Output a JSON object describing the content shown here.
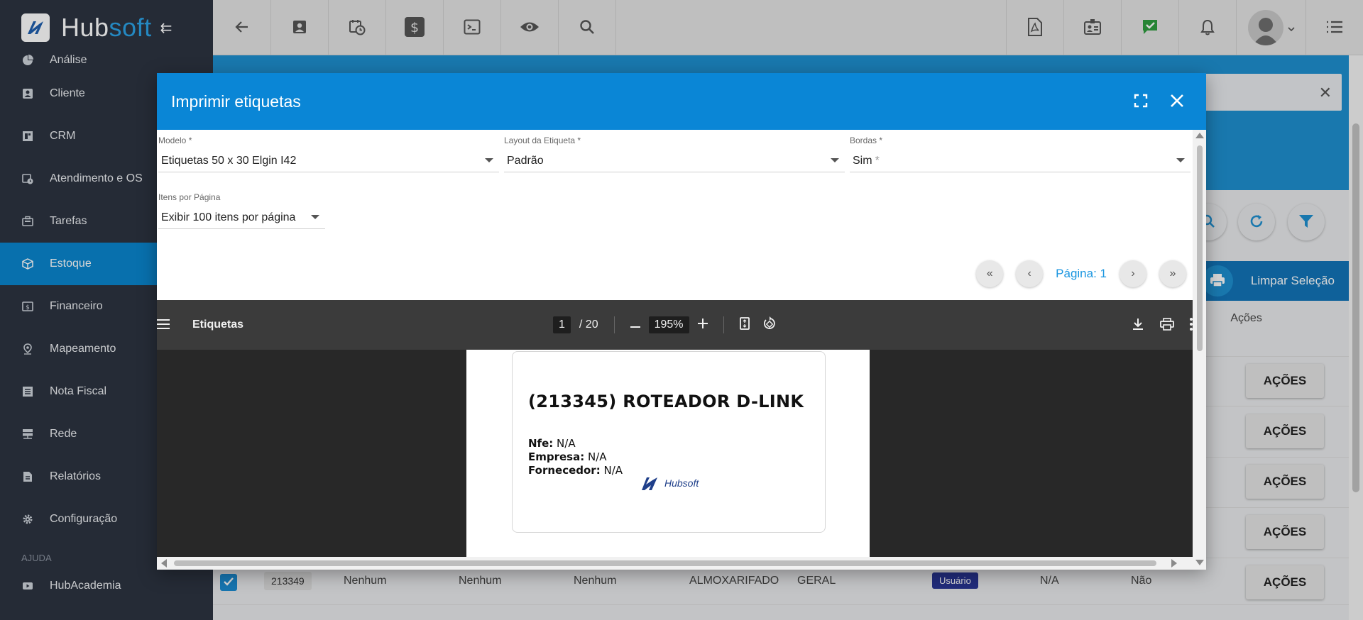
{
  "app": {
    "brand": {
      "part1": "Hub",
      "part2": "soft"
    },
    "colors": {
      "primary": "#0a86d6",
      "sidebar": "#2d3441",
      "accent_link": "#1b96e0",
      "badge": "#283593"
    }
  },
  "topbar": {
    "left_icons": [
      "back-arrow-icon",
      "contact-card-icon",
      "calendar-clock-icon",
      "dollar-icon",
      "terminal-icon",
      "eye-icon",
      "search-icon"
    ],
    "right_icons": [
      "pdf-icon",
      "id-card-icon",
      "check-icon",
      "bell-icon",
      "avatar",
      "list-icon"
    ]
  },
  "sidebar": {
    "items": [
      {
        "label": "Análise",
        "icon": "pie-chart-icon"
      },
      {
        "label": "Cliente",
        "icon": "contact-card-icon"
      },
      {
        "label": "CRM",
        "icon": "dashboard-icon"
      },
      {
        "label": "Atendimento e OS",
        "icon": "calendar-clock-icon"
      },
      {
        "label": "Tarefas",
        "icon": "briefcase-icon"
      },
      {
        "label": "Estoque",
        "icon": "cube-icon"
      },
      {
        "label": "Financeiro",
        "icon": "money-icon"
      },
      {
        "label": "Mapeamento",
        "icon": "map-pin-icon"
      },
      {
        "label": "Nota Fiscal",
        "icon": "document-list-icon"
      },
      {
        "label": "Rede",
        "icon": "server-icon"
      },
      {
        "label": "Relatórios",
        "icon": "report-icon"
      },
      {
        "label": "Configuração",
        "icon": "gear-icon"
      }
    ],
    "section": "AJUDA",
    "help_item": {
      "label": "HubAcademia",
      "icon": "play-icon"
    }
  },
  "background": {
    "clear_selection": "Limpar Seleção",
    "column_actions": "Ações",
    "column_partial": "o",
    "actions_label": "AÇÕES",
    "last_row": {
      "id": "213349",
      "c1": "Nenhum",
      "c2": "Nenhum",
      "c3": "Nenhum",
      "local": "ALMOXARIFADO",
      "tipo": "GERAL",
      "badge": "Usuário",
      "na": "N/A",
      "nao": "Não"
    }
  },
  "modal": {
    "title": "Imprimir etiquetas",
    "fields": {
      "modelo": {
        "label": "Modelo *",
        "value": "Etiquetas 50 x 30 Elgin I42"
      },
      "layout": {
        "label": "Layout da Etiqueta *",
        "value": "Padrão"
      },
      "bordas": {
        "label": "Bordas *",
        "value": "Sim",
        "req": "*"
      },
      "itens": {
        "label": "Itens por Página",
        "value": "Exibir 100 itens por página"
      }
    },
    "pager": {
      "label": "Página: 1"
    },
    "pdf": {
      "title": "Etiquetas",
      "page_current": "1",
      "page_total": "/ 20",
      "zoom": "195%",
      "label": {
        "title": "(213345) ROTEADOR D-LINK",
        "nfe_key": "Nfe:",
        "nfe_val": "N/A",
        "empresa_key": "Empresa:",
        "empresa_val": "N/A",
        "fornecedor_key": "Fornecedor:",
        "fornecedor_val": "N/A",
        "logo_text": "Hubsoft"
      }
    }
  }
}
